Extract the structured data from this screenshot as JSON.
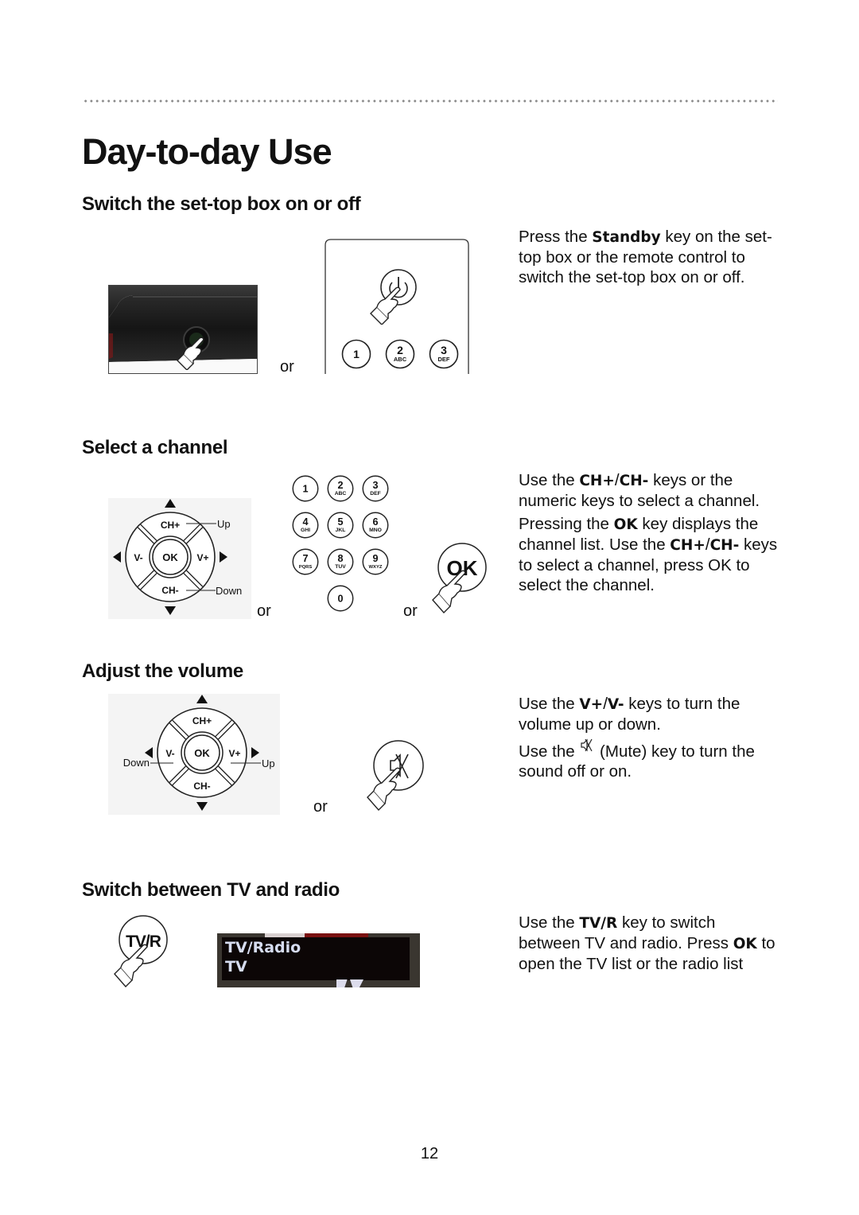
{
  "page": {
    "title": "Day-to-day Use",
    "page_number": "12",
    "connector_word": "or"
  },
  "sections": [
    {
      "heading": "Switch the set-top box on or off",
      "paragraphs": [
        [
          {
            "text": "Press the "
          },
          {
            "text": "Standby",
            "bold": true
          },
          {
            "text": " key on the set-top box or the remote control to switch the set-top box on or off."
          }
        ]
      ],
      "illustrations": {
        "remote_keys": [
          {
            "num": "1",
            "letters": ""
          },
          {
            "num": "2",
            "letters": "ABC"
          },
          {
            "num": "3",
            "letters": "DEF"
          }
        ],
        "icons": [
          "settop-box-photo",
          "standby-button-icon",
          "hand-pointer-icon"
        ]
      }
    },
    {
      "heading": "Select a channel",
      "paragraphs": [
        [
          {
            "text": "Use the "
          },
          {
            "text": "CH+",
            "bold": true
          },
          {
            "text": "/"
          },
          {
            "text": "CH-",
            "bold": true
          },
          {
            "text": " keys or the numeric keys to select a channel."
          }
        ],
        [
          {
            "text": "Pressing the "
          },
          {
            "text": "OK",
            "bold": true
          },
          {
            "text": " key displays the channel list. Use the "
          },
          {
            "text": "CH+",
            "bold": true
          },
          {
            "text": "/"
          },
          {
            "text": "CH-",
            "bold": true
          },
          {
            "text": " keys to select a channel, press OK to select the channel."
          }
        ]
      ],
      "illustrations": {
        "dpad": {
          "up": "CH+",
          "down": "CH-",
          "left": "V-",
          "right": "V+",
          "center": "OK",
          "callout_up": "Up",
          "callout_down": "Down"
        },
        "numeric_keys": [
          {
            "num": "1",
            "letters": ""
          },
          {
            "num": "2",
            "letters": "ABC"
          },
          {
            "num": "3",
            "letters": "DEF"
          },
          {
            "num": "4",
            "letters": "GHI"
          },
          {
            "num": "5",
            "letters": "JKL"
          },
          {
            "num": "6",
            "letters": "MNO"
          },
          {
            "num": "7",
            "letters": "PQRS"
          },
          {
            "num": "8",
            "letters": "TUV"
          },
          {
            "num": "9",
            "letters": "WXYZ"
          },
          {
            "num": "0",
            "letters": ""
          }
        ],
        "ok_key_label": "OK"
      }
    },
    {
      "heading": "Adjust the volume",
      "paragraphs": [
        [
          {
            "text": "Use the "
          },
          {
            "text": "V+",
            "bold": true
          },
          {
            "text": "/"
          },
          {
            "text": "V-",
            "bold": true
          },
          {
            "text": " keys to turn the volume up or down."
          }
        ],
        [
          {
            "text": "Use the "
          },
          {
            "icon": "mute-icon"
          },
          {
            "text": " (Mute) key to turn the sound off or on."
          }
        ]
      ],
      "illustrations": {
        "dpad": {
          "up": "CH+",
          "down": "CH-",
          "left": "V-",
          "right": "V+",
          "center": "OK",
          "callout_left": "Down",
          "callout_right": "Up"
        }
      }
    },
    {
      "heading": "Switch between TV and radio",
      "paragraphs": [
        [
          {
            "text": "Use the "
          },
          {
            "text": "TV/R",
            "bold": true
          },
          {
            "text": " key to switch between TV and radio. Press "
          },
          {
            "text": "OK",
            "bold": true
          },
          {
            "text": " to open the TV list or the radio list"
          }
        ]
      ],
      "illustrations": {
        "tvr_key_label": "TV/R",
        "osd_title": "TV/Radio",
        "osd_value": "TV"
      }
    }
  ]
}
